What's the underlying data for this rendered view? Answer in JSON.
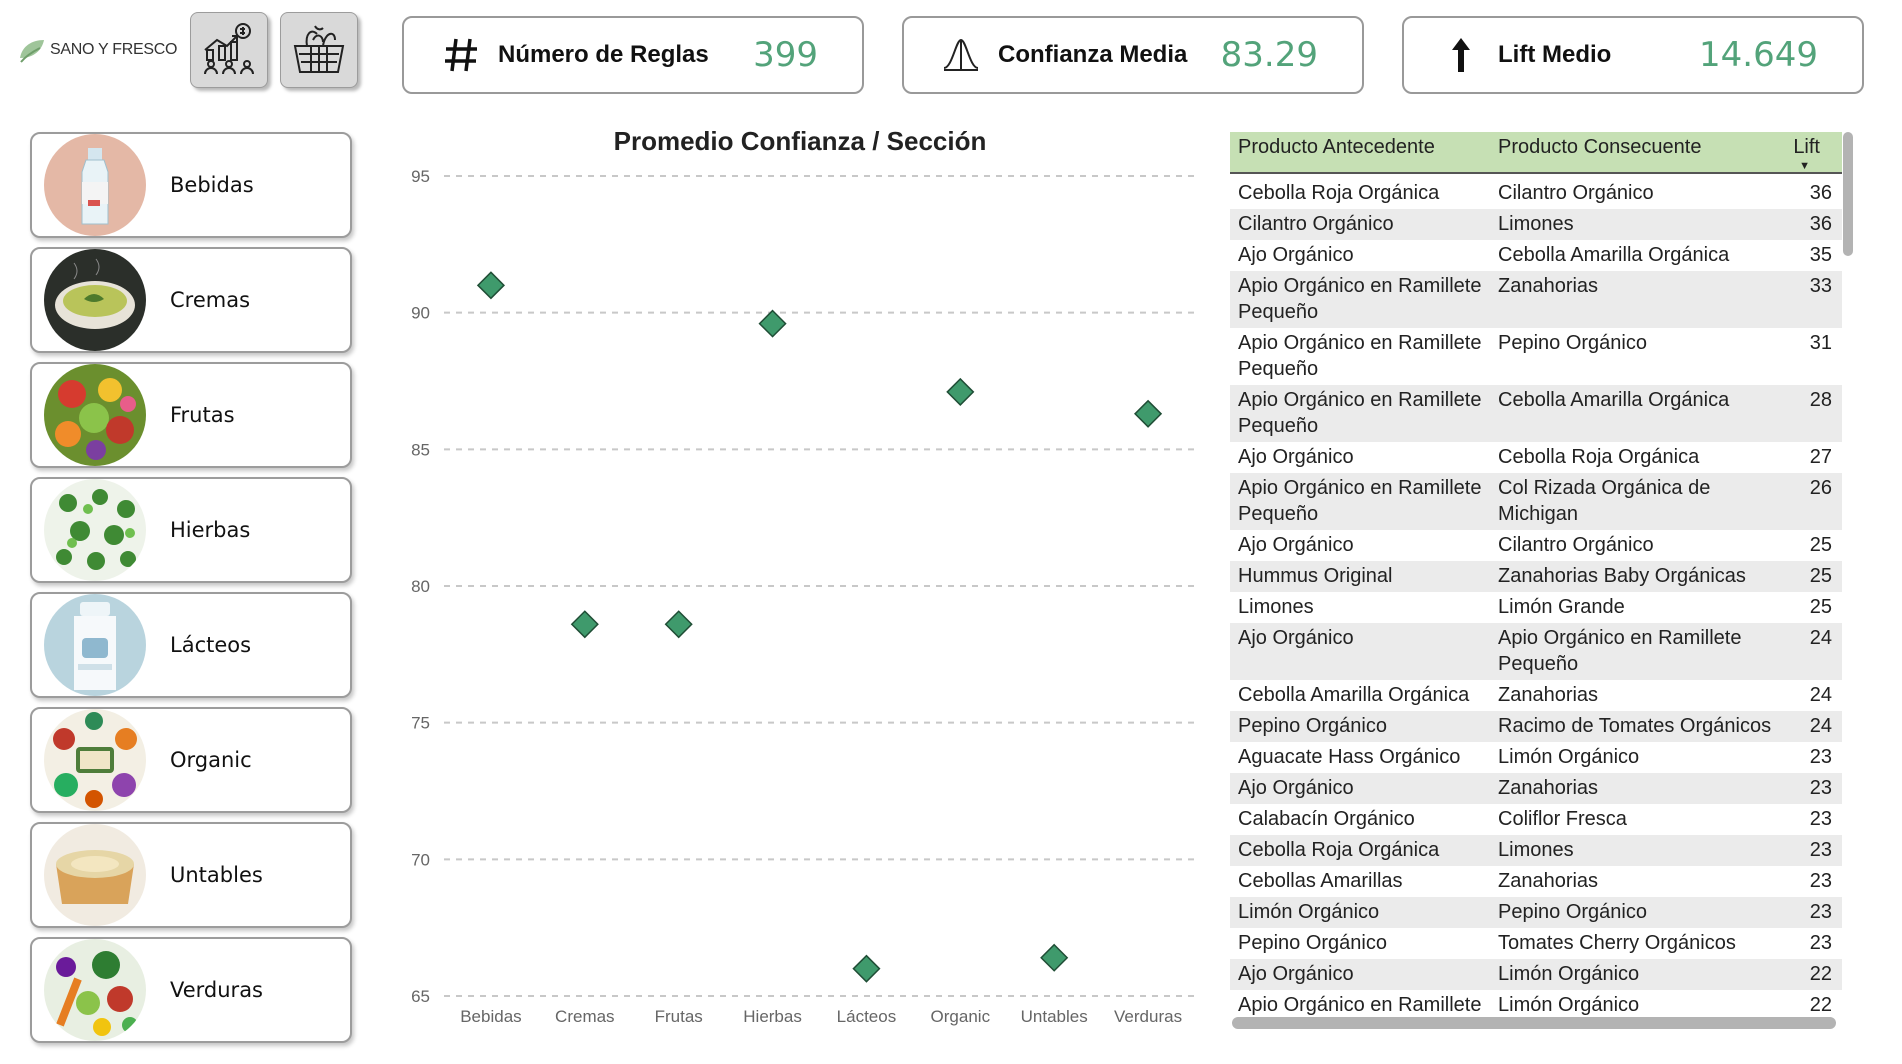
{
  "brand": {
    "name": "SANO Y FRESCO"
  },
  "nav": [
    {
      "name": "analytics-people-icon"
    },
    {
      "name": "basket-icon"
    }
  ],
  "kpis": [
    {
      "icon": "hash-icon",
      "label": "Número de Reglas",
      "value": "399"
    },
    {
      "icon": "bell-curve-icon",
      "label": "Confianza Media",
      "value": "83.29"
    },
    {
      "icon": "arrow-up-icon",
      "label": "Lift Medio",
      "value": "14.649"
    }
  ],
  "sidebar": {
    "items": [
      {
        "label": "Bebidas",
        "icon": "bottle-icon"
      },
      {
        "label": "Cremas",
        "icon": "soup-bowl-icon"
      },
      {
        "label": "Frutas",
        "icon": "fruits-icon"
      },
      {
        "label": "Hierbas",
        "icon": "herbs-icon"
      },
      {
        "label": "Lácteos",
        "icon": "milk-icon"
      },
      {
        "label": "Organic",
        "icon": "organic-produce-icon"
      },
      {
        "label": "Untables",
        "icon": "spread-icon"
      },
      {
        "label": "Verduras",
        "icon": "vegetables-icon"
      }
    ]
  },
  "chart_data": {
    "type": "scatter",
    "title": "Promedio Confianza / Sección",
    "xlabel": "",
    "ylabel": "",
    "categories": [
      "Bebidas",
      "Cremas",
      "Frutas",
      "Hierbas",
      "Lácteos",
      "Organic",
      "Untables",
      "Verduras"
    ],
    "values": [
      91.0,
      78.6,
      78.6,
      89.6,
      66.0,
      87.1,
      66.4,
      86.3
    ],
    "ylim": [
      65,
      95
    ],
    "yticks": [
      95,
      90,
      85,
      80,
      75,
      70,
      65
    ],
    "grid": true,
    "marker": "diamond",
    "color": "#3f9a6c"
  },
  "table": {
    "headers": [
      "Producto Antecedente",
      "Producto Consecuente",
      "Lift"
    ],
    "sort": "desc",
    "header_color": "#c6e0b4",
    "rows": [
      [
        "Cebolla Roja Orgánica",
        "Cilantro Orgánico",
        "36"
      ],
      [
        "Cilantro Orgánico",
        "Limones",
        "36"
      ],
      [
        "Ajo Orgánico",
        "Cebolla Amarilla Orgánica",
        "35"
      ],
      [
        "Apio Orgánico en Ramillete Pequeño",
        "Zanahorias",
        "33"
      ],
      [
        "Apio Orgánico en Ramillete Pequeño",
        "Pepino Orgánico",
        "31"
      ],
      [
        "Apio Orgánico en Ramillete Pequeño",
        "Cebolla Amarilla Orgánica",
        "28"
      ],
      [
        "Ajo Orgánico",
        "Cebolla Roja Orgánica",
        "27"
      ],
      [
        "Apio Orgánico en Ramillete Pequeño",
        "Col Rizada Orgánica de Michigan",
        "26"
      ],
      [
        "Ajo Orgánico",
        "Cilantro Orgánico",
        "25"
      ],
      [
        "Hummus Original",
        "Zanahorias Baby Orgánicas",
        "25"
      ],
      [
        "Limones",
        "Limón Grande",
        "25"
      ],
      [
        "Ajo Orgánico",
        "Apio Orgánico en Ramillete Pequeño",
        "24"
      ],
      [
        "Cebolla Amarilla Orgánica",
        "Zanahorias",
        "24"
      ],
      [
        "Pepino Orgánico",
        "Racimo de Tomates Orgánicos",
        "24"
      ],
      [
        "Aguacate Hass Orgánico",
        "Limón Orgánico",
        "23"
      ],
      [
        "Ajo Orgánico",
        "Zanahorias",
        "23"
      ],
      [
        "Calabacín Orgánico",
        "Coliflor Fresca",
        "23"
      ],
      [
        "Cebolla Roja Orgánica",
        "Limones",
        "23"
      ],
      [
        "Cebollas Amarillas",
        "Zanahorias",
        "23"
      ],
      [
        "Limón Orgánico",
        "Pepino Orgánico",
        "23"
      ],
      [
        "Pepino Orgánico",
        "Tomates Cherry Orgánicos",
        "23"
      ],
      [
        "Ajo Orgánico",
        "Limón Orgánico",
        "22"
      ],
      [
        "Apio Orgánico en Ramillete",
        "Limón Orgánico",
        "22"
      ]
    ]
  }
}
